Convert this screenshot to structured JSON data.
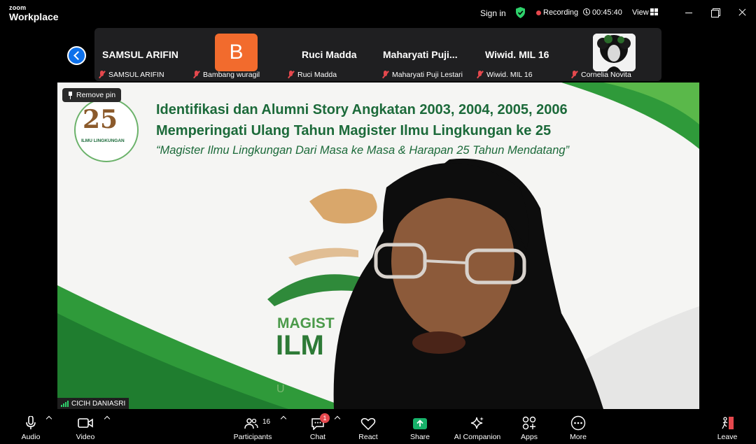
{
  "titlebar": {
    "brand_top": "zoom",
    "brand_bottom": "Workplace",
    "sign_in": "Sign in",
    "recording": "Recording",
    "timer": "00:45:40",
    "view": "View",
    "shield_color": "#2ed16b",
    "record_color": "#e5484d"
  },
  "strip": {
    "tiles": [
      {
        "display": "SAMSUL ARIFIN",
        "label": "SAMSUL ARIFIN"
      },
      {
        "display": "B",
        "label": "Bambang wuragil"
      },
      {
        "display": "Ruci Madda",
        "label": "Ruci Madda"
      },
      {
        "display": "Maharyati  Puji...",
        "label": "Maharyati Puji Lestari"
      },
      {
        "display": "Wiwid. MIL 16",
        "label": "Wiwid. MIL 16"
      },
      {
        "display": "",
        "label": "Cornelia Novita"
      }
    ],
    "avatar_color": "#f26b2d"
  },
  "main": {
    "remove_pin": "Remove pin",
    "slide": {
      "line1": "Identifikasi dan Alumni Story Angkatan 2003, 2004, 2005, 2006",
      "line2": "Memperingati Ulang Tahun Magister Ilmu Lingkungan ke 25",
      "line3": "“Magister Ilmu Lingkungan Dari Masa ke Masa & Harapan 25 Tahun Mendatang”",
      "logo_number": "25",
      "logo_text": "ILMU LINGKUNGAN",
      "bg_magist": "MAGIST",
      "bg_ilm": "ILM",
      "bg_u": "U"
    },
    "speaker": "CICIH DANIASRI"
  },
  "toolbar": {
    "audio": "Audio",
    "video": "Video",
    "participants": "Participants",
    "participants_count": "16",
    "chat": "Chat",
    "chat_badge": "1",
    "react": "React",
    "share": "Share",
    "ai_companion": "AI Companion",
    "apps": "Apps",
    "more": "More",
    "leave": "Leave",
    "share_color": "#17b26a",
    "leave_color": "#e5484d"
  }
}
